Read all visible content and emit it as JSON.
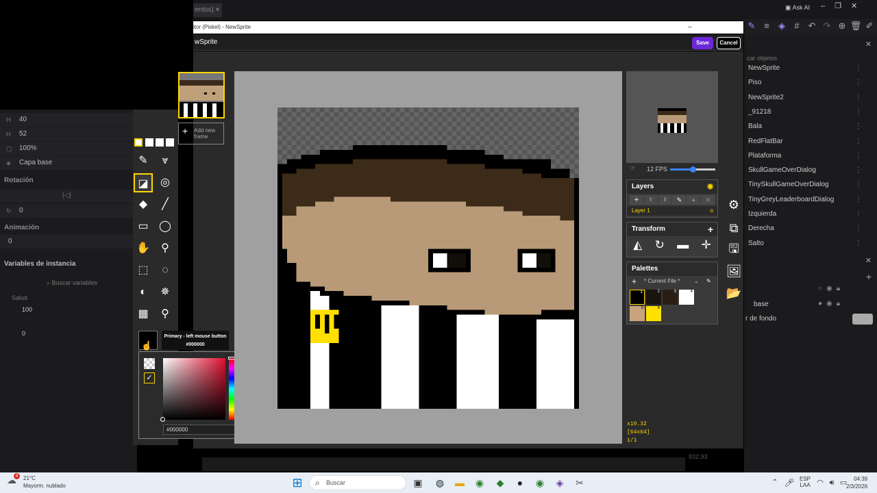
{
  "gdevelop": {
    "tab_label": "entos)",
    "ask_ai": "Ask AI",
    "left_panel": {
      "width_value": "40",
      "height_value": "52",
      "scale_value": "100%",
      "layer_value": "Capa base",
      "rotation_label": "Rotación",
      "angle_value": "0",
      "animation_label": "Animación",
      "animation_value": "0",
      "instance_vars_label": "Variables de instancia",
      "search_vars_placeholder": "Buscar variables",
      "var_name": "Salud",
      "var_value_1": "100",
      "var_value_2": "0"
    },
    "right_panel": {
      "search_placeholder": "car objetos",
      "objects": [
        "NewSprite",
        "Piso",
        "NewSprite2",
        "_91218",
        "Bala",
        "RedFlatBar",
        "Plataforma",
        "SkullGameOverDialog",
        "TinySkullGameOverDialog",
        "TinyGreyLeaderboardDialog",
        "Izquierda",
        "Derecha",
        "Salto"
      ],
      "layer_base": "base",
      "background_color": "r de fondo"
    },
    "bottom_coord": "832,93"
  },
  "piskel": {
    "window_title": "itor (Piskel) - NewSprite",
    "sprite_name": "wSprite",
    "save_label": "Save",
    "cancel_label": "Cancel",
    "add_frame_label": "Add new frame",
    "fps_label": "12 FPS",
    "layers_title": "Layers",
    "layer_name": "Layer 1",
    "layer_opacity": "o",
    "transform_title": "Transform",
    "palettes_title": "Palettes",
    "palette_name": "* Current File *",
    "palette_colors": [
      "#000000",
      "#1a1410",
      "#2a1e14",
      "#ffffff",
      "#c8a47e",
      "#ffe000"
    ],
    "tooltip_title": "Primary - left mouse button",
    "tooltip_value": "#000000",
    "color_hex_value": "#000000",
    "zoom": "x10.32",
    "dimensions": "[64x64]",
    "frame_index": "1/1"
  },
  "taskbar": {
    "weather_temp": "21°C",
    "weather_desc": "Mayorm. nublado",
    "search_placeholder": "Buscar",
    "lang": "ESP",
    "lang_sub": "LAA",
    "time": "04:39",
    "date": "2/3/2026",
    "notification_badge": "4"
  }
}
